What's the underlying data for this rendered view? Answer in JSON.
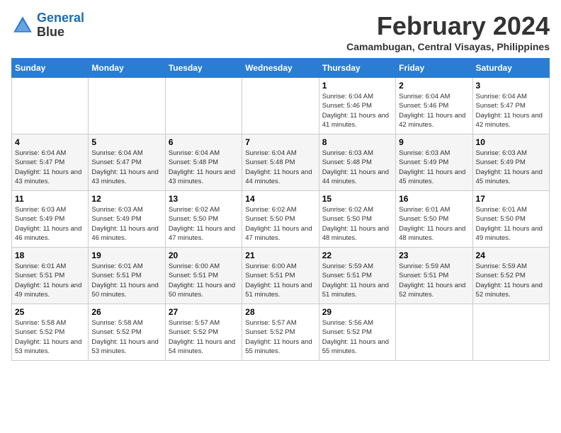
{
  "logo": {
    "line1": "General",
    "line2": "Blue"
  },
  "title": "February 2024",
  "subtitle": "Camambugan, Central Visayas, Philippines",
  "days_header": [
    "Sunday",
    "Monday",
    "Tuesday",
    "Wednesday",
    "Thursday",
    "Friday",
    "Saturday"
  ],
  "weeks": [
    [
      {
        "day": "",
        "sunrise": "",
        "sunset": "",
        "daylight": ""
      },
      {
        "day": "",
        "sunrise": "",
        "sunset": "",
        "daylight": ""
      },
      {
        "day": "",
        "sunrise": "",
        "sunset": "",
        "daylight": ""
      },
      {
        "day": "",
        "sunrise": "",
        "sunset": "",
        "daylight": ""
      },
      {
        "day": "1",
        "sunrise": "Sunrise: 6:04 AM",
        "sunset": "Sunset: 5:46 PM",
        "daylight": "Daylight: 11 hours and 41 minutes."
      },
      {
        "day": "2",
        "sunrise": "Sunrise: 6:04 AM",
        "sunset": "Sunset: 5:46 PM",
        "daylight": "Daylight: 11 hours and 42 minutes."
      },
      {
        "day": "3",
        "sunrise": "Sunrise: 6:04 AM",
        "sunset": "Sunset: 5:47 PM",
        "daylight": "Daylight: 11 hours and 42 minutes."
      }
    ],
    [
      {
        "day": "4",
        "sunrise": "Sunrise: 6:04 AM",
        "sunset": "Sunset: 5:47 PM",
        "daylight": "Daylight: 11 hours and 43 minutes."
      },
      {
        "day": "5",
        "sunrise": "Sunrise: 6:04 AM",
        "sunset": "Sunset: 5:47 PM",
        "daylight": "Daylight: 11 hours and 43 minutes."
      },
      {
        "day": "6",
        "sunrise": "Sunrise: 6:04 AM",
        "sunset": "Sunset: 5:48 PM",
        "daylight": "Daylight: 11 hours and 43 minutes."
      },
      {
        "day": "7",
        "sunrise": "Sunrise: 6:04 AM",
        "sunset": "Sunset: 5:48 PM",
        "daylight": "Daylight: 11 hours and 44 minutes."
      },
      {
        "day": "8",
        "sunrise": "Sunrise: 6:03 AM",
        "sunset": "Sunset: 5:48 PM",
        "daylight": "Daylight: 11 hours and 44 minutes."
      },
      {
        "day": "9",
        "sunrise": "Sunrise: 6:03 AM",
        "sunset": "Sunset: 5:49 PM",
        "daylight": "Daylight: 11 hours and 45 minutes."
      },
      {
        "day": "10",
        "sunrise": "Sunrise: 6:03 AM",
        "sunset": "Sunset: 5:49 PM",
        "daylight": "Daylight: 11 hours and 45 minutes."
      }
    ],
    [
      {
        "day": "11",
        "sunrise": "Sunrise: 6:03 AM",
        "sunset": "Sunset: 5:49 PM",
        "daylight": "Daylight: 11 hours and 46 minutes."
      },
      {
        "day": "12",
        "sunrise": "Sunrise: 6:03 AM",
        "sunset": "Sunset: 5:49 PM",
        "daylight": "Daylight: 11 hours and 46 minutes."
      },
      {
        "day": "13",
        "sunrise": "Sunrise: 6:02 AM",
        "sunset": "Sunset: 5:50 PM",
        "daylight": "Daylight: 11 hours and 47 minutes."
      },
      {
        "day": "14",
        "sunrise": "Sunrise: 6:02 AM",
        "sunset": "Sunset: 5:50 PM",
        "daylight": "Daylight: 11 hours and 47 minutes."
      },
      {
        "day": "15",
        "sunrise": "Sunrise: 6:02 AM",
        "sunset": "Sunset: 5:50 PM",
        "daylight": "Daylight: 11 hours and 48 minutes."
      },
      {
        "day": "16",
        "sunrise": "Sunrise: 6:01 AM",
        "sunset": "Sunset: 5:50 PM",
        "daylight": "Daylight: 11 hours and 48 minutes."
      },
      {
        "day": "17",
        "sunrise": "Sunrise: 6:01 AM",
        "sunset": "Sunset: 5:50 PM",
        "daylight": "Daylight: 11 hours and 49 minutes."
      }
    ],
    [
      {
        "day": "18",
        "sunrise": "Sunrise: 6:01 AM",
        "sunset": "Sunset: 5:51 PM",
        "daylight": "Daylight: 11 hours and 49 minutes."
      },
      {
        "day": "19",
        "sunrise": "Sunrise: 6:01 AM",
        "sunset": "Sunset: 5:51 PM",
        "daylight": "Daylight: 11 hours and 50 minutes."
      },
      {
        "day": "20",
        "sunrise": "Sunrise: 6:00 AM",
        "sunset": "Sunset: 5:51 PM",
        "daylight": "Daylight: 11 hours and 50 minutes."
      },
      {
        "day": "21",
        "sunrise": "Sunrise: 6:00 AM",
        "sunset": "Sunset: 5:51 PM",
        "daylight": "Daylight: 11 hours and 51 minutes."
      },
      {
        "day": "22",
        "sunrise": "Sunrise: 5:59 AM",
        "sunset": "Sunset: 5:51 PM",
        "daylight": "Daylight: 11 hours and 51 minutes."
      },
      {
        "day": "23",
        "sunrise": "Sunrise: 5:59 AM",
        "sunset": "Sunset: 5:51 PM",
        "daylight": "Daylight: 11 hours and 52 minutes."
      },
      {
        "day": "24",
        "sunrise": "Sunrise: 5:59 AM",
        "sunset": "Sunset: 5:52 PM",
        "daylight": "Daylight: 11 hours and 52 minutes."
      }
    ],
    [
      {
        "day": "25",
        "sunrise": "Sunrise: 5:58 AM",
        "sunset": "Sunset: 5:52 PM",
        "daylight": "Daylight: 11 hours and 53 minutes."
      },
      {
        "day": "26",
        "sunrise": "Sunrise: 5:58 AM",
        "sunset": "Sunset: 5:52 PM",
        "daylight": "Daylight: 11 hours and 53 minutes."
      },
      {
        "day": "27",
        "sunrise": "Sunrise: 5:57 AM",
        "sunset": "Sunset: 5:52 PM",
        "daylight": "Daylight: 11 hours and 54 minutes."
      },
      {
        "day": "28",
        "sunrise": "Sunrise: 5:57 AM",
        "sunset": "Sunset: 5:52 PM",
        "daylight": "Daylight: 11 hours and 55 minutes."
      },
      {
        "day": "29",
        "sunrise": "Sunrise: 5:56 AM",
        "sunset": "Sunset: 5:52 PM",
        "daylight": "Daylight: 11 hours and 55 minutes."
      },
      {
        "day": "",
        "sunrise": "",
        "sunset": "",
        "daylight": ""
      },
      {
        "day": "",
        "sunrise": "",
        "sunset": "",
        "daylight": ""
      }
    ]
  ]
}
